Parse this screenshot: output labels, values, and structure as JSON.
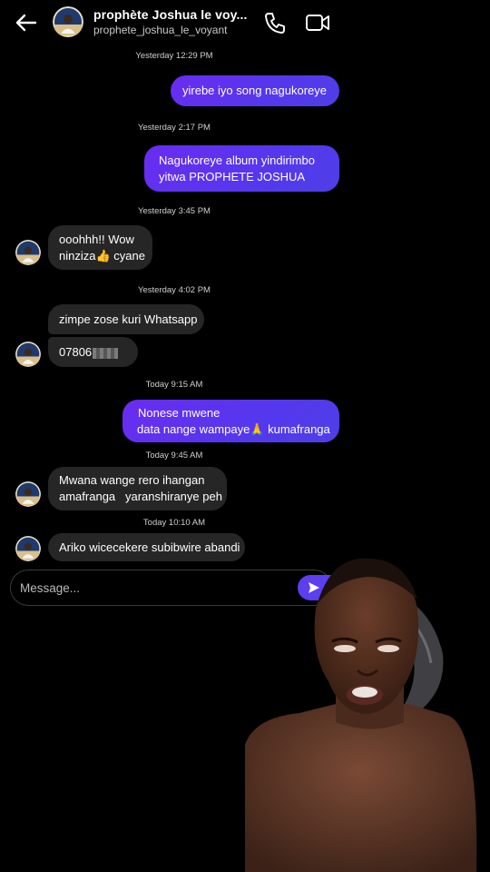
{
  "header": {
    "title": "prophète Joshua le voy...",
    "username": "prophete_joshua_le_voyant",
    "back_icon": "arrow-left-icon",
    "call_icon": "phone-icon",
    "video_icon": "video-camera-icon"
  },
  "timestamps": [
    "Yesterday 12:29 PM",
    "Yesterday 2:17 PM",
    "Yesterday 3:45 PM",
    "Yesterday 4:02 PM",
    "Today 9:15 AM",
    "Today 9:45 AM",
    "Today 10:10 AM"
  ],
  "messages": {
    "m1": {
      "line1": "yirebe iyo song nagukoreye"
    },
    "m2": {
      "line1": "Nagukoreye album yindirimbo",
      "line2": "yitwa PROPHETE JOSHUA"
    },
    "m3": {
      "line1": "ooohhh!! Wow",
      "line2": "ninziza👍 cyane"
    },
    "m4": {
      "line1": "zimpe zose kuri Whatsapp"
    },
    "m5": {
      "line1": "07806"
    },
    "m6": {
      "line1": "Nonese mwene",
      "line2": "data nange wampaye🙏 kumafranga"
    },
    "m7": {
      "line1": "Mwana wange rero ihangan",
      "line2": "amafranga   yaranshiranye peh"
    },
    "m8": {
      "line1": "Ariko wicecekere subibwire abandi"
    }
  },
  "composer": {
    "placeholder": "Message..."
  },
  "colors": {
    "outgoing": "#5b35ee",
    "incoming": "#262626",
    "background": "#000000"
  }
}
